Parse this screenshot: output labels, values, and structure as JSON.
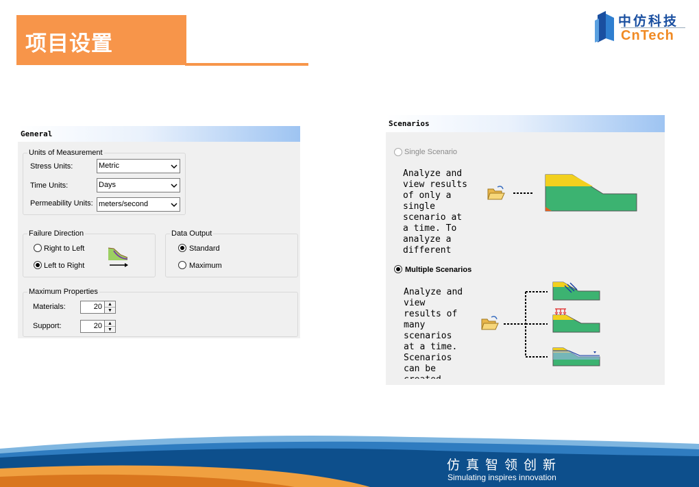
{
  "header": {
    "title": "项目设置"
  },
  "logo": {
    "cn": "中仿科技",
    "en": "CnTech"
  },
  "general": {
    "panel_title": "General",
    "units_group": "Units of Measurement",
    "stress_label": "Stress Units:",
    "stress_value": "Metric",
    "time_label": "Time Units:",
    "time_value": "Days",
    "perm_label": "Permeability Units:",
    "perm_value": "meters/second",
    "failure_group": "Failure Direction",
    "right_to_left": "Right to Left",
    "left_to_right": "Left to Right",
    "output_group": "Data Output",
    "standard": "Standard",
    "maximum": "Maximum",
    "maxprops_group": "Maximum Properties",
    "materials_label": "Materials:",
    "materials_value": "20",
    "support_label": "Support:",
    "support_value": "20"
  },
  "scenarios": {
    "panel_title": "Scenarios",
    "single_label": "Single Scenario",
    "single_desc": "Analyze and\nview results\nof only a\nsingle\nscenario at\na time. To\nanalyze a\ndifferent",
    "multiple_label": "Multiple Scenarios",
    "multiple_desc": "Analyze and\nview\nresults of\nmany\nscenarios\nat a time.\nScenarios\ncan be\ncreated"
  },
  "footer": {
    "slogan_cn": "仿真智领创新",
    "slogan_en": "Simulating inspires innovation"
  },
  "colors": {
    "accent_orange": "#f7954a",
    "logo_blue": "#1a4fa0",
    "footer_blue": "#0d4f8c",
    "slope_green": "#3cb371",
    "slope_yellow": "#f2d01e"
  },
  "icons": [
    "folder-open-icon",
    "slope-direction-icon",
    "slope-model-icon",
    "dropdown-arrow-icon"
  ]
}
